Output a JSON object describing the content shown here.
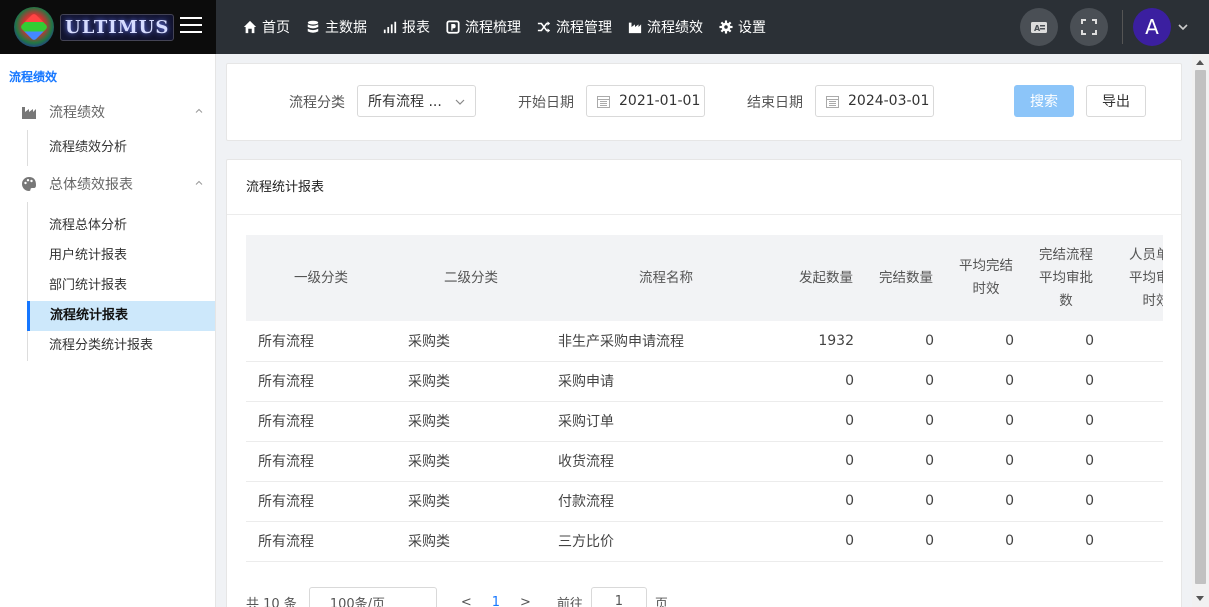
{
  "app": {
    "logo_text": "ULTIMUS"
  },
  "nav": {
    "items": [
      {
        "label": "首页",
        "icon": "home-icon"
      },
      {
        "label": "主数据",
        "icon": "database-icon"
      },
      {
        "label": "报表",
        "icon": "bar-signal-icon"
      },
      {
        "label": "流程梳理",
        "icon": "p-box-icon"
      },
      {
        "label": "流程管理",
        "icon": "shuffle-icon"
      },
      {
        "label": "流程绩效",
        "icon": "factory-icon"
      },
      {
        "label": "设置",
        "icon": "gear-icon"
      }
    ]
  },
  "user": {
    "avatar_letter": "A"
  },
  "sidebar": {
    "title": "流程绩效",
    "groups": [
      {
        "label": "流程绩效",
        "icon": "factory-icon",
        "items": [
          "流程绩效分析"
        ]
      },
      {
        "label": "总体绩效报表",
        "icon": "palette-icon",
        "items": [
          "流程总体分析",
          "用户统计报表",
          "部门统计报表",
          "流程统计报表",
          "流程分类统计报表"
        ]
      }
    ],
    "active_item": "流程统计报表"
  },
  "filter": {
    "category_label": "流程分类",
    "category_value": "所有流程 ...",
    "start_label": "开始日期",
    "start_value": "2021-01-01",
    "end_label": "结束日期",
    "end_value": "2024-03-01",
    "search_button": "搜索",
    "export_button": "导出"
  },
  "report": {
    "title": "流程统计报表",
    "columns": [
      "一级分类",
      "二级分类",
      "流程名称",
      "发起数量",
      "完结数量",
      "平均完结\n时效",
      "完结流程\n平均审批\n数",
      "人员单次\n平均审批\n时效"
    ],
    "rows": [
      [
        "所有流程",
        "采购类",
        "非生产采购申请流程",
        "1932",
        "0",
        "0",
        "0",
        ""
      ],
      [
        "所有流程",
        "采购类",
        "采购申请",
        "0",
        "0",
        "0",
        "0",
        ""
      ],
      [
        "所有流程",
        "采购类",
        "采购订单",
        "0",
        "0",
        "0",
        "0",
        ""
      ],
      [
        "所有流程",
        "采购类",
        "收货流程",
        "0",
        "0",
        "0",
        "0",
        ""
      ],
      [
        "所有流程",
        "采购类",
        "付款流程",
        "0",
        "0",
        "0",
        "0",
        ""
      ],
      [
        "所有流程",
        "采购类",
        "三方比价",
        "0",
        "0",
        "0",
        "0",
        ""
      ]
    ]
  },
  "pagination": {
    "total_text": "共 10 条",
    "page_size": "100条/页",
    "prev": "<",
    "current_page": "1",
    "next": ">",
    "goto_label": "前往",
    "goto_value": "1",
    "page_unit": "页"
  }
}
